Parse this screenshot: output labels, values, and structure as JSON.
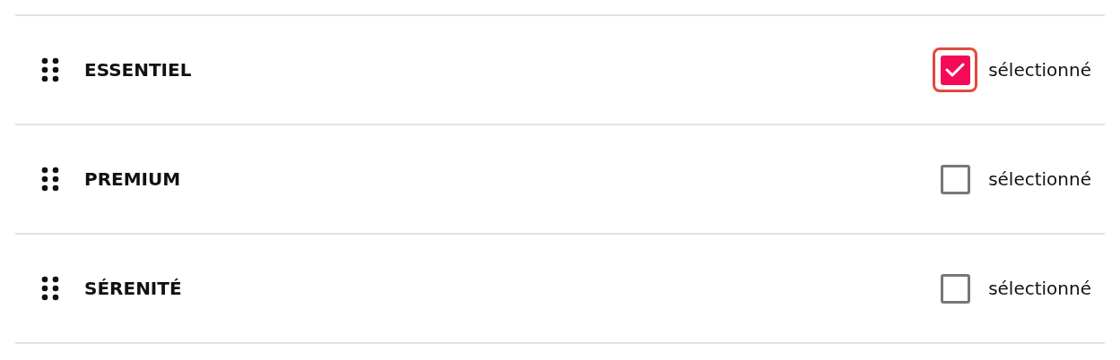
{
  "options": [
    {
      "label": "ESSENTIEL",
      "checked": true,
      "focused": true,
      "checkbox_label": "sélectionné"
    },
    {
      "label": "PREMIUM",
      "checked": false,
      "focused": false,
      "checkbox_label": "sélectionné"
    },
    {
      "label": "SÉRENITÉ",
      "checked": false,
      "focused": false,
      "checkbox_label": "sélectionné"
    }
  ]
}
